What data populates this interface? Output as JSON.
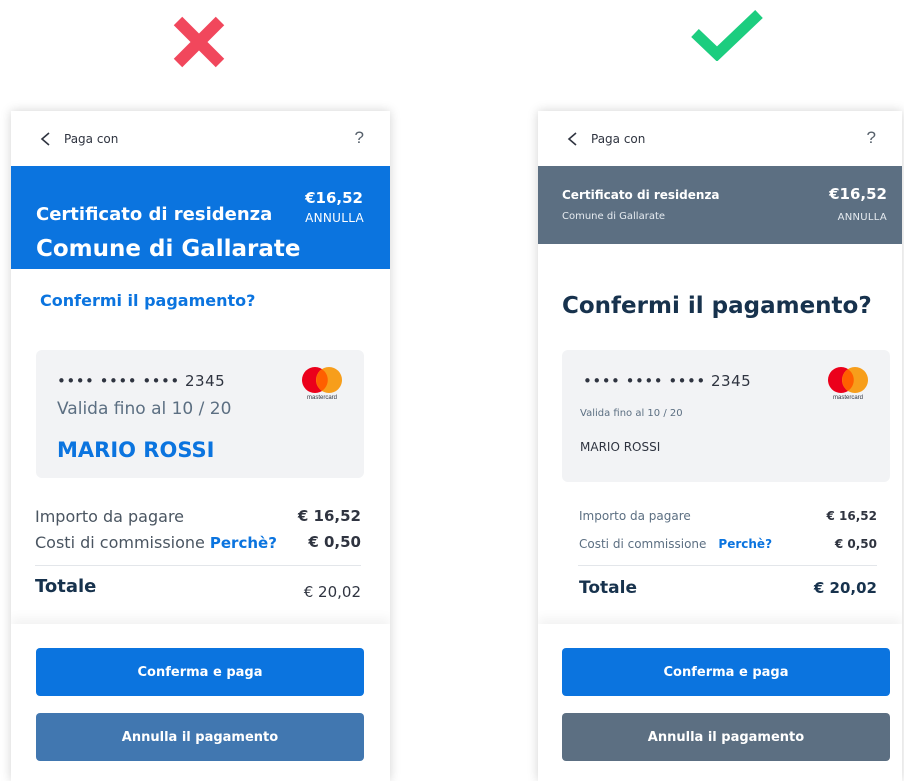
{
  "marks": {
    "bad": "cross-icon",
    "good": "check-icon",
    "bad_color": "#f1475c",
    "good_color": "#1ccd7f"
  },
  "screens": [
    {
      "variant": "bad",
      "topbar": {
        "title": "Paga con",
        "help": "?"
      },
      "header": {
        "document": "Certificato di residenza",
        "price": "€16,52",
        "cancel": "ANNULLA",
        "municipality": "Comune di Gallarate",
        "background": "#0b74df"
      },
      "question": "Confermi il pagamento?",
      "card": {
        "number": "•••• •••• •••• 2345",
        "valid": "Valida fino al 10 / 20",
        "holder": "MARIO ROSSI",
        "brand": "mastercard"
      },
      "summary": {
        "amount_label": "Importo da pagare",
        "amount": "€ 16,52",
        "fee_label": "Costi di commissione",
        "fee_why": "Perchè?",
        "fee": "€ 0,50",
        "total_label": "Totale",
        "total": "€ 20,02"
      },
      "buttons": {
        "confirm": "Conferma e paga",
        "cancel": "Annulla il pagamento"
      }
    },
    {
      "variant": "good",
      "topbar": {
        "title": "Paga con",
        "help": "?"
      },
      "header": {
        "document": "Certificato di residenza",
        "price": "€16,52",
        "cancel": "ANNULLA",
        "municipality": "Comune di Gallarate",
        "background": "#5c6f82"
      },
      "question": "Confermi il pagamento?",
      "card": {
        "number": "•••• •••• •••• 2345",
        "valid": "Valida fino al 10 / 20",
        "holder": "MARIO ROSSI",
        "brand": "mastercard"
      },
      "summary": {
        "amount_label": "Importo da pagare",
        "amount": "€ 16,52",
        "fee_label": "Costi di commissione",
        "fee_why": "Perchè?",
        "fee": "€ 0,50",
        "total_label": "Totale",
        "total": "€ 20,02"
      },
      "buttons": {
        "confirm": "Conferma e paga",
        "cancel": "Annulla il pagamento"
      }
    }
  ]
}
